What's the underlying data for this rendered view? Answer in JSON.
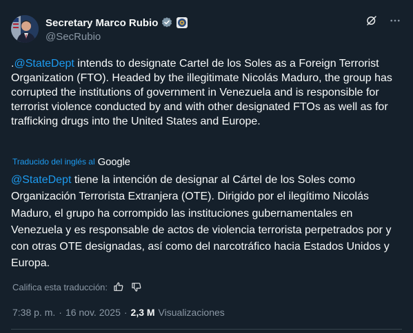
{
  "author": {
    "display_name": "Secretary Marco Rubio",
    "handle": "@SecRubio"
  },
  "post": {
    "prefix": ".",
    "mention": "@StateDept",
    "text": " intends to designate Cartel de los Soles as a Foreign Terrorist Organization (FTO). Headed by the illegitimate Nicolás Maduro, the group has corrupted the institutions of government in Venezuela and is responsible for terrorist violence conducted by and with other designated FTOs as well as for trafficking drugs into the United States and Europe."
  },
  "translation": {
    "label": "Traducido del inglés al",
    "provider": "Google",
    "mention": "@StateDept",
    "text": " tiene la intención de designar al Cártel de los Soles como Organización Terrorista Extranjera (OTE). Dirigido por el ilegítimo Nicolás Maduro, el grupo ha corrompido las instituciones gubernamentales en Venezuela y es responsable de actos de violencia terrorista perpetrados por y con otras OTE designadas, así como del narcotráfico hacia Estados Unidos y Europa.",
    "rate_label": "Califica esta traducción:"
  },
  "meta": {
    "time": "7:38 p. m.",
    "separator": "·",
    "date": "16 nov. 2025",
    "views_count": "2,3 M",
    "views_label": "Visualizaciones"
  },
  "icons": {
    "verified": "verified-badge-icon",
    "seal": "government-seal-icon",
    "grok": "grok-icon",
    "more": "more-icon",
    "thumbs_up": "thumbs-up-icon",
    "thumbs_down": "thumbs-down-icon"
  },
  "colors": {
    "background": "#15202b",
    "text": "#f7f9f9",
    "secondary": "#8b98a5",
    "accent": "#1d9bf0"
  }
}
